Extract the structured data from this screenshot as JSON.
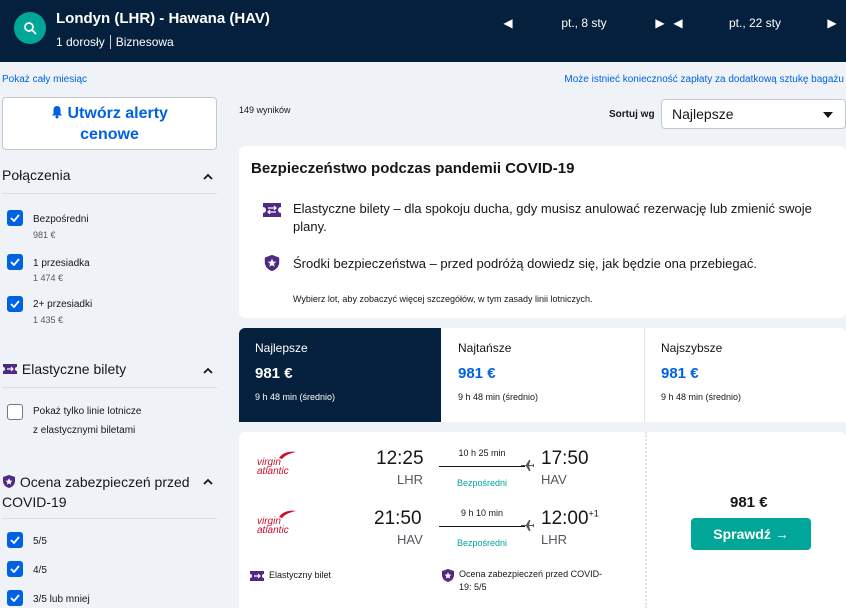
{
  "header": {
    "route": "Londyn (LHR) - Hawana (HAV)",
    "passengers": "1 dorosły",
    "cabin": "Biznesowa",
    "depart_date": "pt., 8 sty",
    "return_date": "pt., 22 sty",
    "arrow_left": "◀",
    "arrow_right": "▶"
  },
  "links": {
    "month": "Pokaż cały miesiąc",
    "bag_note": "Może istnieć konieczność zapłaty za dodatkową sztukę bagażu"
  },
  "sidebar": {
    "alert_line1": "Utwórz alerty",
    "alert_line2": "cenowe",
    "stops": {
      "title": "Połączenia",
      "items": [
        {
          "label": "Bezpośredni",
          "price": "981 €"
        },
        {
          "label": "1 przesiadka",
          "price": "1 474 €"
        },
        {
          "label": "2+ przesiadki",
          "price": "1 435 €"
        }
      ]
    },
    "flex": {
      "title": "Elastyczne bilety",
      "option_line1": "Pokaż tylko linie lotnicze",
      "option_line2": "z elastycznymi biletami"
    },
    "covid": {
      "title_line1": "Ocena zabezpieczeń przed",
      "title_line2": "COVID-19",
      "items": [
        "5/5",
        "4/5",
        "3/5 lub mniej"
      ]
    }
  },
  "main": {
    "results_count": "149 wyników",
    "sort_label": "Sortuj wg",
    "sort_value": "Najlepsze",
    "covid_card": {
      "title": "Bezpieczeństwo podczas pandemii COVID-19",
      "line1": "Elastyczne bilety – dla spokoju ducha, gdy musisz anulować rezerwację lub zmienić swoje plany.",
      "line2": "Środki bezpieczeństwa – przed podróżą dowiedz się, jak będzie ona przebiegać.",
      "note": "Wybierz lot, aby zobaczyć więcej szczegółów, w tym zasady linii lotniczych."
    },
    "tabs": [
      {
        "name": "Najlepsze",
        "price": "981 €",
        "duration": "9 h 48 min (średnio)"
      },
      {
        "name": "Najtańsze",
        "price": "981 €",
        "duration": "9 h 48 min (średnio)"
      },
      {
        "name": "Najszybsze",
        "price": "981 €",
        "duration": "9 h 48 min (średnio)"
      }
    ],
    "ticket": {
      "airline_line1": "virgin",
      "airline_line2": "atlantic",
      "outbound": {
        "dep_time": "12:25",
        "dep_code": "LHR",
        "duration": "10 h 25 min",
        "stops": "Bezpośredni",
        "arr_time": "17:50",
        "arr_code": "HAV"
      },
      "inbound": {
        "dep_time": "21:50",
        "dep_code": "HAV",
        "duration": "9 h 10 min",
        "stops": "Bezpośredni",
        "arr_time": "12:00",
        "arr_day": "+1",
        "arr_code": "LHR"
      },
      "flex_label": "Elastyczny bilet",
      "safety_line1": "Ocena zabezpieczeń przed COVID-",
      "safety_line2": "19: 5/5",
      "price": "981 €",
      "button": "Sprawdź",
      "button_arrow": "→"
    }
  },
  "colors": {
    "navy": "#05203c",
    "teal": "#00a698",
    "blue": "#0062e3",
    "airline_red": "#c8102e"
  }
}
